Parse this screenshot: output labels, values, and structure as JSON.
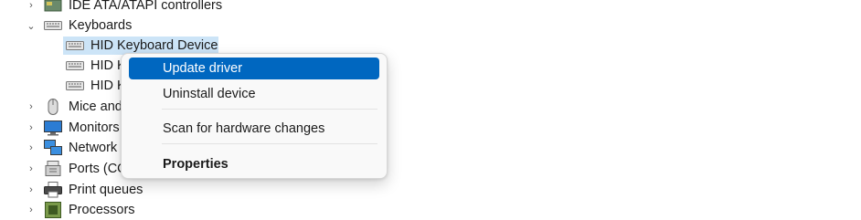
{
  "tree": {
    "items": [
      {
        "label": "IDE ATA/ATAPI controllers",
        "icon": "ide-controller-icon",
        "expander": "›"
      },
      {
        "label": "Keyboards",
        "icon": "keyboard-icon",
        "expander": "⌄"
      },
      {
        "label": "HID Keyboard Device",
        "icon": "keyboard-icon"
      },
      {
        "label": "HID K",
        "icon": "keyboard-icon"
      },
      {
        "label": "HID K",
        "icon": "keyboard-icon"
      },
      {
        "label": "Mice and",
        "icon": "mouse-icon",
        "expander": "›"
      },
      {
        "label": "Monitors",
        "icon": "monitor-icon",
        "expander": "›"
      },
      {
        "label": "Network",
        "icon": "network-icon",
        "expander": "›"
      },
      {
        "label": "Ports (CO",
        "icon": "port-icon",
        "expander": "›"
      },
      {
        "label": "Print queues",
        "icon": "printer-icon",
        "expander": "›"
      },
      {
        "label": "Processors",
        "icon": "processor-icon",
        "expander": "›"
      }
    ]
  },
  "context_menu": {
    "update_driver": "Update driver",
    "uninstall_device": "Uninstall device",
    "scan_hardware": "Scan for hardware changes",
    "properties": "Properties"
  },
  "colors": {
    "menu_highlight": "#0067c0",
    "selection": "#cce4f7"
  }
}
